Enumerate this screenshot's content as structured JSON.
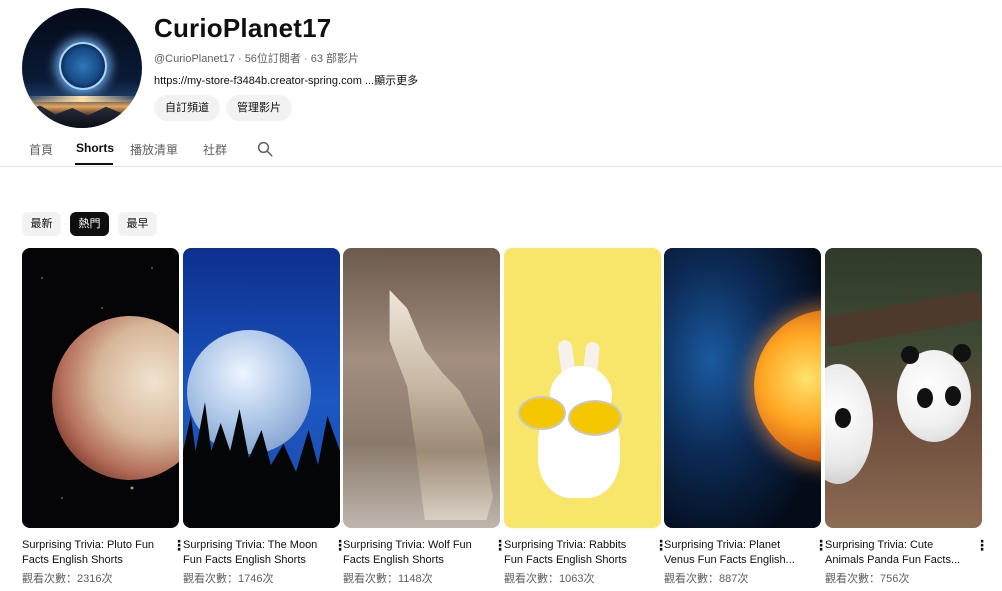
{
  "channel": {
    "name": "CurioPlanet17",
    "handle": "@CurioPlanet17",
    "subscribers": "56位訂閱者",
    "video_count": "63 部影片",
    "link": "https://my-store-f3484b.creator-spring.com",
    "more": "...顯示更多",
    "customize_label": "自訂頻道",
    "manage_label": "管理影片"
  },
  "tabs": [
    {
      "label": "首頁"
    },
    {
      "label": "Shorts"
    },
    {
      "label": "播放清單"
    },
    {
      "label": "社群"
    }
  ],
  "filters": [
    {
      "label": "最新"
    },
    {
      "label": "熱門",
      "active": true
    },
    {
      "label": "最早"
    }
  ],
  "shorts": [
    {
      "title": "Surprising Trivia: Pluto Fun Facts English Shorts",
      "views": "觀看次數：2316次",
      "thumb": "pluto"
    },
    {
      "title": "Surprising Trivia: The Moon Fun Facts English Shorts",
      "views": "觀看次數：1746次",
      "thumb": "moon"
    },
    {
      "title": "Surprising Trivia: Wolf Fun Facts English Shorts",
      "views": "觀看次數：1148次",
      "thumb": "wolf"
    },
    {
      "title": "Surprising Trivia: Rabbits Fun Facts English Shorts",
      "views": "觀看次數：1063次",
      "thumb": "rabbit"
    },
    {
      "title": "Surprising Trivia: Planet Venus Fun Facts English...",
      "views": "觀看次數：887次",
      "thumb": "venus"
    },
    {
      "title": "Surprising Trivia: Cute Animals Panda Fun Facts...",
      "views": "觀看次數：756次",
      "thumb": "panda"
    }
  ],
  "colors": {
    "chip_active": "#0f0f0f",
    "chip_inactive": "#f2f2f2",
    "secondary_text": "#606060"
  }
}
